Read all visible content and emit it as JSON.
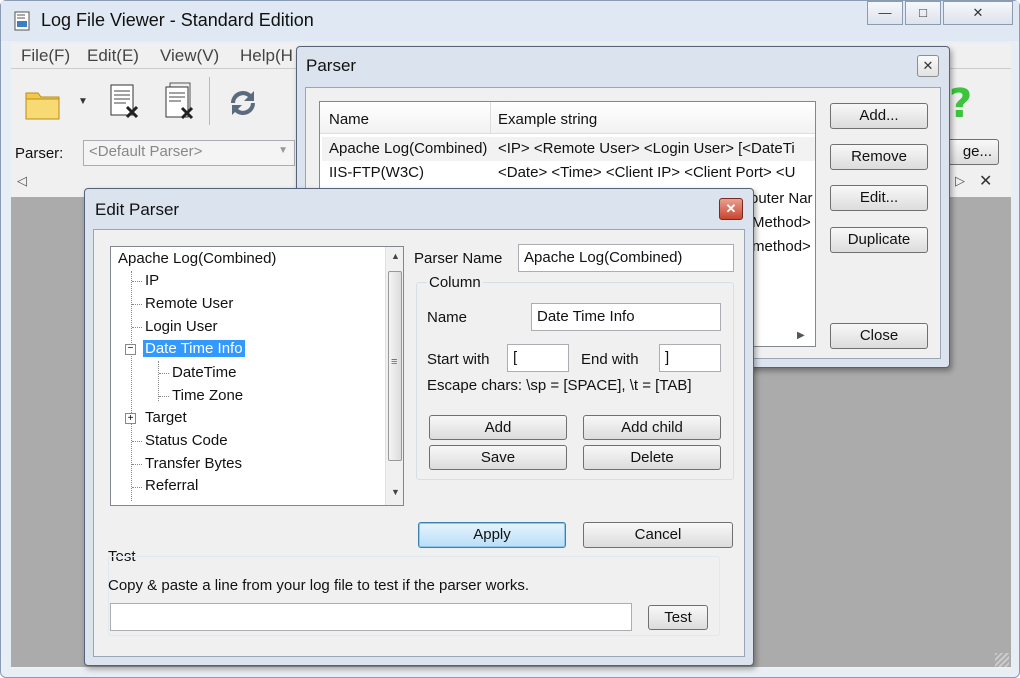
{
  "main_window": {
    "title": "Log File Viewer - Standard Edition",
    "menu": [
      "File(F)",
      "Edit(E)",
      "View(V)",
      "Help(H"
    ],
    "parser_label": "Parser:",
    "parser_select_value": "<Default Parser>",
    "manage_button": "ge..."
  },
  "parser_dialog": {
    "title": "Parser",
    "columns": [
      "Name",
      "Example string"
    ],
    "rows": [
      {
        "name": "Apache Log(Combined)",
        "example": "<IP> <Remote User> <Login User> [<DateTi"
      },
      {
        "name": "IIS-FTP(W3C)",
        "example": "<Date> <Time> <Client IP> <Client Port> <U"
      }
    ],
    "partial_rows": [
      "outer Nar",
      "Method>",
      "method>"
    ],
    "buttons": {
      "add": "Add...",
      "remove": "Remove",
      "edit": "Edit...",
      "duplicate": "Duplicate",
      "close": "Close"
    }
  },
  "edit_parser_dialog": {
    "title": "Edit Parser",
    "tree": {
      "root": "Apache Log(Combined)",
      "items": [
        "IP",
        "Remote User",
        "Login User",
        "Date Time Info",
        "DateTime",
        "Time Zone",
        "Target",
        "Status Code",
        "Transfer Bytes",
        "Referral"
      ]
    },
    "parser_name_label": "Parser Name",
    "parser_name_value": "Apache Log(Combined)",
    "column_group": "Column",
    "name_label": "Name",
    "name_value": "Date Time Info",
    "start_with_label": "Start with",
    "start_with_value": "[",
    "end_with_label": "End with",
    "end_with_value": "]",
    "escape_text": "Escape chars: \\sp = [SPACE], \\t = [TAB]",
    "buttons": {
      "add": "Add",
      "add_child": "Add child",
      "save": "Save",
      "delete": "Delete",
      "apply": "Apply",
      "cancel": "Cancel",
      "test": "Test"
    },
    "test_group": "Test",
    "test_hint": "Copy & paste a line from your log file to test if the parser works.",
    "test_input_value": ""
  },
  "icons": [
    "app-icon",
    "open-folder-icon",
    "dropdown-arrow-icon",
    "close-file-icon",
    "close-all-icon",
    "refresh-icon",
    "help-icon",
    "tab-left-icon",
    "tab-right-icon",
    "tab-close-icon"
  ],
  "colors": {
    "selection": "#3399ff",
    "title_bg": "#dfe8f3",
    "grey_area": "#ababab",
    "primary_button": "#b9def7"
  }
}
